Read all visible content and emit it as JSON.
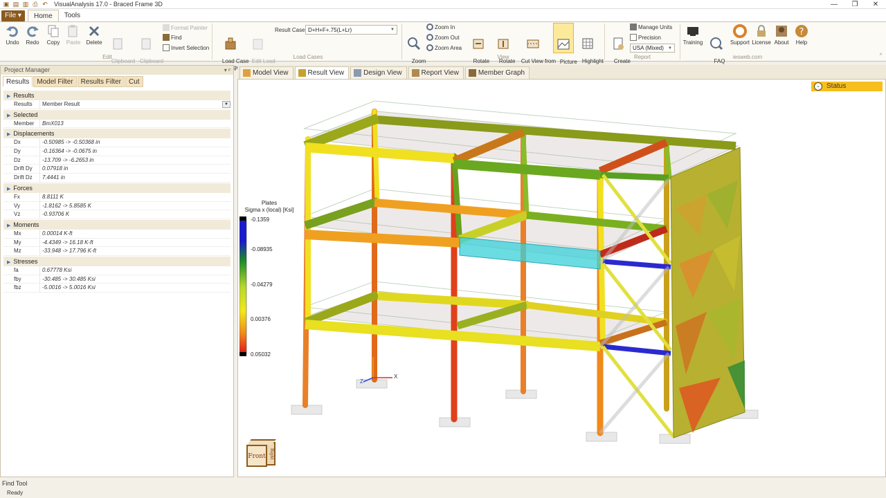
{
  "window": {
    "title": "VisualAnalysis 17.0 - Braced Frame 3D",
    "controls": [
      "—",
      "❐",
      "✕"
    ]
  },
  "ribbon_tabs": {
    "file": "File ▾",
    "home": "Home",
    "tools": "Tools"
  },
  "ribbon": {
    "undo": "Undo",
    "redo": "Redo",
    "copy": "Copy",
    "paste": "Paste",
    "delete": "Delete",
    "clip_export": "Clipboard\nExport",
    "clip_import": "Clipboard\nImport",
    "format_painter": "Format Painter",
    "find": "Find",
    "invert_selection": "Invert Selection",
    "group_edit": "Edit",
    "load_case_manager": "Load Case\nManager",
    "edit_load_case": "Edit Load\nCase",
    "result_case_label": "Result Case",
    "result_case_value": "D+H+F+.75(L+Lr)",
    "group_load_cases": "Load Cases",
    "zoom_all": "Zoom\nAll",
    "zoom_in": "Zoom In",
    "zoom_out": "Zoom Out",
    "zoom_area": "Zoom Area",
    "rotate_horizontal": "Rotate\nHorizontal",
    "rotate_vertical": "Rotate\nVertical",
    "cut_view": "Cut View from\nSelected",
    "picture_view": "Picture\nView",
    "highlight_view": "Highlight\nView",
    "group_view": "View",
    "create_report": "Create\nReport",
    "manage_units": "Manage Units",
    "precision": "Precision",
    "units_value": "USA (Mixed)",
    "group_report": "Report",
    "training": "Training",
    "faq": "FAQ\nAnswers",
    "support": "Support",
    "license": "License",
    "about": "About",
    "help": "Help",
    "group_web": "iesweb.com"
  },
  "project_manager": {
    "title": "Project Manager",
    "tabs": [
      "Results",
      "Model Filter",
      "Results Filter",
      "Cut"
    ],
    "sections": [
      {
        "name": "Results",
        "rows": [
          {
            "k": "Results",
            "v": "Member Result",
            "dropdown": true
          }
        ]
      },
      {
        "name": "Selected",
        "rows": [
          {
            "k": "Member",
            "v": "BmX013"
          }
        ]
      },
      {
        "name": "Displacements",
        "rows": [
          {
            "k": "Dx",
            "v": "-0.50985 -> -0.50368 in"
          },
          {
            "k": "Dy",
            "v": "-0.16364 -> -0.0675 in"
          },
          {
            "k": "Dz",
            "v": "-13.709 -> -6.2653 in"
          },
          {
            "k": "Drift Dy",
            "v": "0.07918 in"
          },
          {
            "k": "Drift Dz",
            "v": "7.4441 in"
          }
        ]
      },
      {
        "name": "Forces",
        "rows": [
          {
            "k": "Fx",
            "v": "8.8111 K"
          },
          {
            "k": "Vy",
            "v": "-1.8162 -> 5.8585 K"
          },
          {
            "k": "Vz",
            "v": "-0.93706 K"
          }
        ]
      },
      {
        "name": "Moments",
        "rows": [
          {
            "k": "Mx",
            "v": "0.00014 K-ft"
          },
          {
            "k": "My",
            "v": "-4.4349 -> 16.18 K-ft"
          },
          {
            "k": "Mz",
            "v": "-33.948 -> 17.796 K-ft"
          }
        ]
      },
      {
        "name": "Stresses",
        "rows": [
          {
            "k": "fa",
            "v": "0.67778 Ksi"
          },
          {
            "k": "fby",
            "v": "-30.485 -> 30.485 Ksi"
          },
          {
            "k": "fbz",
            "v": "-5.0016 -> 5.0016 Ksi"
          }
        ]
      }
    ]
  },
  "doc_tabs": [
    "Model View",
    "Result View",
    "Design View",
    "Report View",
    "Member Graph"
  ],
  "active_doc_tab": 1,
  "viewport": {
    "status": "Status",
    "legend": {
      "title": "Plates",
      "subtitle": "Sigma x (local) [Ksi]",
      "labels": [
        "-0.1359",
        "-0.08935",
        "-0.04279",
        "0.00376",
        "0.05032"
      ]
    },
    "axis": {
      "x": "X",
      "z": "Z"
    },
    "view_cube": {
      "front": "Front",
      "right": "Right"
    }
  },
  "find_tool": "Find Tool",
  "status_bar": "Ready",
  "colors": {
    "accent": "#8a5a1e",
    "status": "#f7bf1e",
    "active_btn": "#fde99a"
  }
}
